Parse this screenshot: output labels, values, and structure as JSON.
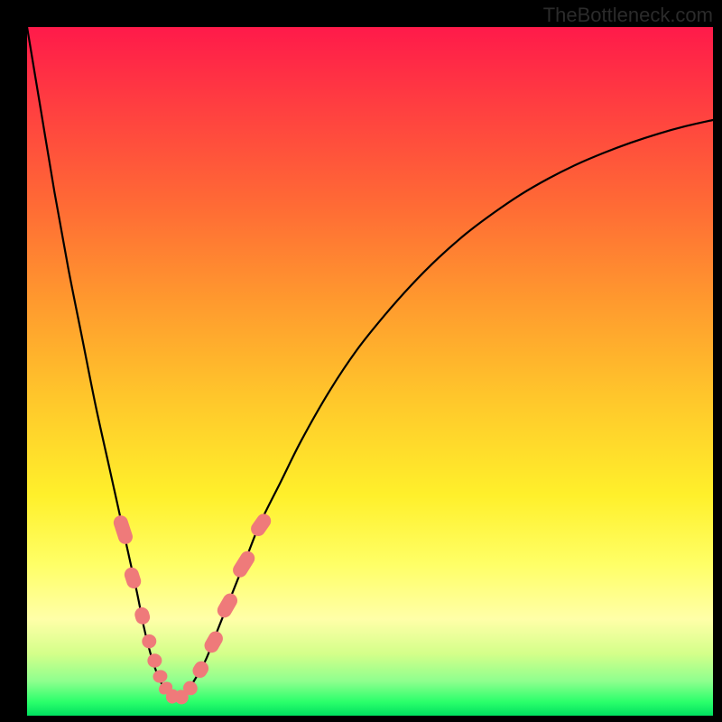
{
  "watermark": "TheBottleneck.com",
  "colors": {
    "frame": "#000000",
    "curve": "#000000",
    "markers_fill": "#ef7a7a",
    "markers_stroke": "#c85a5a"
  },
  "chart_data": {
    "type": "line",
    "title": "",
    "xlabel": "",
    "ylabel": "",
    "xlim": [
      0,
      100
    ],
    "ylim": [
      0,
      100
    ],
    "note": "No numeric axes or ticks are rendered; curve is reconstructed from pixel positions. x and y_pct are in percentage of plot-area width/height (y_pct measured from top).",
    "series": [
      {
        "name": "bottleneck-curve",
        "x": [
          0,
          2,
          4,
          6,
          8,
          10,
          12,
          14,
          16,
          17,
          18,
          19,
          20,
          21,
          22,
          23,
          24,
          26,
          28,
          30,
          32,
          34,
          37,
          40,
          44,
          48,
          52,
          56,
          60,
          64,
          68,
          72,
          76,
          80,
          84,
          88,
          92,
          96,
          100
        ],
        "y_pct": [
          0,
          12,
          24,
          35,
          45,
          55,
          64,
          73,
          82,
          87,
          91,
          94,
          96,
          97,
          97.5,
          97,
          95.5,
          92,
          87,
          82,
          77,
          72,
          66,
          60,
          53,
          47,
          42,
          37.5,
          33.5,
          30,
          27,
          24.3,
          22,
          20,
          18.3,
          16.8,
          15.5,
          14.4,
          13.5
        ]
      }
    ],
    "markers": {
      "name": "highlighted-segments",
      "shape": "rounded-pill",
      "points": [
        {
          "x": 14.0,
          "y_pct": 73,
          "len": 5.5,
          "angle": 72
        },
        {
          "x": 15.4,
          "y_pct": 80,
          "len": 4.0,
          "angle": 72
        },
        {
          "x": 16.8,
          "y_pct": 85.5,
          "len": 3.2,
          "angle": 74
        },
        {
          "x": 17.8,
          "y_pct": 89.2,
          "len": 2.6,
          "angle": 76
        },
        {
          "x": 18.6,
          "y_pct": 92.0,
          "len": 2.6,
          "angle": 78
        },
        {
          "x": 19.4,
          "y_pct": 94.3,
          "len": 2.4,
          "angle": 80
        },
        {
          "x": 20.2,
          "y_pct": 96.0,
          "len": 2.2,
          "angle": 55
        },
        {
          "x": 21.2,
          "y_pct": 97.2,
          "len": 2.4,
          "angle": 15
        },
        {
          "x": 22.5,
          "y_pct": 97.3,
          "len": 2.6,
          "angle": -18
        },
        {
          "x": 23.8,
          "y_pct": 96.0,
          "len": 2.6,
          "angle": -50
        },
        {
          "x": 25.3,
          "y_pct": 93.3,
          "len": 3.2,
          "angle": -58
        },
        {
          "x": 27.2,
          "y_pct": 89.3,
          "len": 4.2,
          "angle": -60
        },
        {
          "x": 29.2,
          "y_pct": 84.0,
          "len": 4.8,
          "angle": -60
        },
        {
          "x": 31.6,
          "y_pct": 78.0,
          "len": 5.3,
          "angle": -58
        },
        {
          "x": 34.1,
          "y_pct": 72.3,
          "len": 4.5,
          "angle": -55
        }
      ]
    }
  }
}
